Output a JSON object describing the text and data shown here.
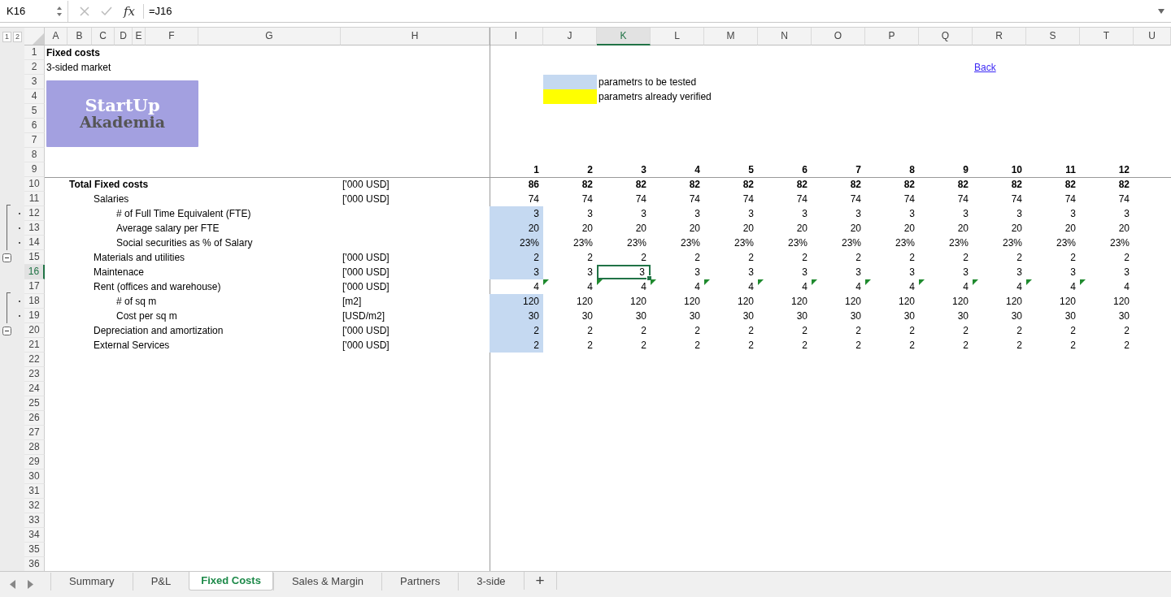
{
  "formula_bar": {
    "name_box": "K16",
    "function_label": "fx",
    "formula": "=J16"
  },
  "outline_levels": [
    "1",
    "2"
  ],
  "columns": [
    {
      "label": "A",
      "selected": false
    },
    {
      "label": "B",
      "selected": false
    },
    {
      "label": "C",
      "selected": false
    },
    {
      "label": "D",
      "selected": false
    },
    {
      "label": "E",
      "selected": false
    },
    {
      "label": "F",
      "selected": false
    },
    {
      "label": "G",
      "selected": false
    },
    {
      "label": "H",
      "selected": false
    },
    {
      "label": "I",
      "selected": false
    },
    {
      "label": "J",
      "selected": false
    },
    {
      "label": "K",
      "selected": true
    },
    {
      "label": "L",
      "selected": false
    },
    {
      "label": "M",
      "selected": false
    },
    {
      "label": "N",
      "selected": false
    },
    {
      "label": "O",
      "selected": false
    },
    {
      "label": "P",
      "selected": false
    },
    {
      "label": "Q",
      "selected": false
    },
    {
      "label": "R",
      "selected": false
    },
    {
      "label": "S",
      "selected": false
    },
    {
      "label": "T",
      "selected": false
    },
    {
      "label": "U",
      "selected": false
    }
  ],
  "rows": [
    {
      "label": "1",
      "selected": false
    },
    {
      "label": "2",
      "selected": false
    },
    {
      "label": "3",
      "selected": false
    },
    {
      "label": "4",
      "selected": false
    },
    {
      "label": "5",
      "selected": false
    },
    {
      "label": "6",
      "selected": false
    },
    {
      "label": "7",
      "selected": false
    },
    {
      "label": "8",
      "selected": false
    },
    {
      "label": "9",
      "selected": false
    },
    {
      "label": "10",
      "selected": false
    },
    {
      "label": "11",
      "selected": false
    },
    {
      "label": "12",
      "selected": false
    },
    {
      "label": "13",
      "selected": false
    },
    {
      "label": "14",
      "selected": false
    },
    {
      "label": "15",
      "selected": false
    },
    {
      "label": "16",
      "selected": true
    },
    {
      "label": "17",
      "selected": false
    },
    {
      "label": "18",
      "selected": false
    },
    {
      "label": "19",
      "selected": false
    },
    {
      "label": "20",
      "selected": false
    },
    {
      "label": "21",
      "selected": false
    },
    {
      "label": "22",
      "selected": false
    },
    {
      "label": "23",
      "selected": false
    },
    {
      "label": "24",
      "selected": false
    },
    {
      "label": "25",
      "selected": false
    },
    {
      "label": "26",
      "selected": false
    },
    {
      "label": "27",
      "selected": false
    },
    {
      "label": "28",
      "selected": false
    },
    {
      "label": "29",
      "selected": false
    },
    {
      "label": "30",
      "selected": false
    },
    {
      "label": "31",
      "selected": false
    },
    {
      "label": "32",
      "selected": false
    },
    {
      "label": "33",
      "selected": false
    },
    {
      "label": "34",
      "selected": false
    },
    {
      "label": "35",
      "selected": false
    },
    {
      "label": "36",
      "selected": false
    }
  ],
  "title": "Fixed costs",
  "subtitle": "3-sided market",
  "logo": {
    "title": "StartUp",
    "subtitle": "Akademia"
  },
  "legend": [
    {
      "color": "#c5d9f1",
      "label": "parametrs to be tested"
    },
    {
      "color": "#ffff00",
      "label": "parametrs already verified"
    }
  ],
  "back_link": "Back",
  "table": {
    "periods": [
      "1",
      "2",
      "3",
      "4",
      "5",
      "6",
      "7",
      "8",
      "9",
      "10",
      "11",
      "12"
    ],
    "rows": [
      {
        "label": "Total Fixed costs",
        "bold": true,
        "unit": "['000 USD]",
        "input": false,
        "values": [
          "86",
          "82",
          "82",
          "82",
          "82",
          "82",
          "82",
          "82",
          "82",
          "82",
          "82",
          "82"
        ],
        "children": [
          {
            "label": "Salaries",
            "unit": "['000 USD]",
            "input": false,
            "expanded": true,
            "values": [
              "74",
              "74",
              "74",
              "74",
              "74",
              "74",
              "74",
              "74",
              "74",
              "74",
              "74",
              "74"
            ],
            "children": [
              {
                "label": "# of Full Time Equivalent (FTE)",
                "input": true,
                "values": [
                  "3",
                  "3",
                  "3",
                  "3",
                  "3",
                  "3",
                  "3",
                  "3",
                  "3",
                  "3",
                  "3",
                  "3"
                ]
              },
              {
                "label": "Average salary per FTE",
                "input": true,
                "values": [
                  "20",
                  "20",
                  "20",
                  "20",
                  "20",
                  "20",
                  "20",
                  "20",
                  "20",
                  "20",
                  "20",
                  "20"
                ]
              },
              {
                "label": "Social securities as % of Salary",
                "input": true,
                "values": [
                  "23%",
                  "23%",
                  "23%",
                  "23%",
                  "23%",
                  "23%",
                  "23%",
                  "23%",
                  "23%",
                  "23%",
                  "23%",
                  "23%"
                ]
              }
            ]
          },
          {
            "label": "Materials and utilities",
            "unit": "['000 USD]",
            "input": true,
            "values": [
              "2",
              "2",
              "2",
              "2",
              "2",
              "2",
              "2",
              "2",
              "2",
              "2",
              "2",
              "2"
            ]
          },
          {
            "label": "Maintenace",
            "unit": "['000 USD]",
            "input": true,
            "values": [
              "3",
              "3",
              "3",
              "3",
              "3",
              "3",
              "3",
              "3",
              "3",
              "3",
              "3",
              "3"
            ]
          },
          {
            "label": "Rent (offices and warehouse)",
            "unit": "['000 USD]",
            "input": false,
            "expanded": true,
            "values": [
              "4",
              "4",
              "4",
              "4",
              "4",
              "4",
              "4",
              "4",
              "4",
              "4",
              "4",
              "4"
            ],
            "flags": [
              false,
              true,
              true,
              true,
              true,
              true,
              true,
              true,
              true,
              true,
              true,
              true
            ],
            "children": [
              {
                "label": "# of sq m",
                "unit": "[m2]",
                "input": true,
                "values": [
                  "120",
                  "120",
                  "120",
                  "120",
                  "120",
                  "120",
                  "120",
                  "120",
                  "120",
                  "120",
                  "120",
                  "120"
                ]
              },
              {
                "label": "Cost per sq m",
                "unit": "[USD/m2]",
                "input": true,
                "values": [
                  "30",
                  "30",
                  "30",
                  "30",
                  "30",
                  "30",
                  "30",
                  "30",
                  "30",
                  "30",
                  "30",
                  "30"
                ]
              }
            ]
          },
          {
            "label": "Depreciation and amortization",
            "unit": "['000 USD]",
            "input": true,
            "values": [
              "2",
              "2",
              "2",
              "2",
              "2",
              "2",
              "2",
              "2",
              "2",
              "2",
              "2",
              "2"
            ]
          },
          {
            "label": "External Services",
            "unit": "['000 USD]",
            "input": true,
            "values": [
              "2",
              "2",
              "2",
              "2",
              "2",
              "2",
              "2",
              "2",
              "2",
              "2",
              "2",
              "2"
            ]
          }
        ]
      }
    ]
  },
  "tabs": [
    {
      "label": "Summary",
      "selected": false
    },
    {
      "label": "P&L",
      "selected": false
    },
    {
      "label": "Fixed Costs",
      "selected": true
    },
    {
      "label": "Sales & Margin",
      "selected": false
    },
    {
      "label": "Partners",
      "selected": false
    },
    {
      "label": "3-side",
      "selected": false
    }
  ],
  "add_sheet": "+"
}
